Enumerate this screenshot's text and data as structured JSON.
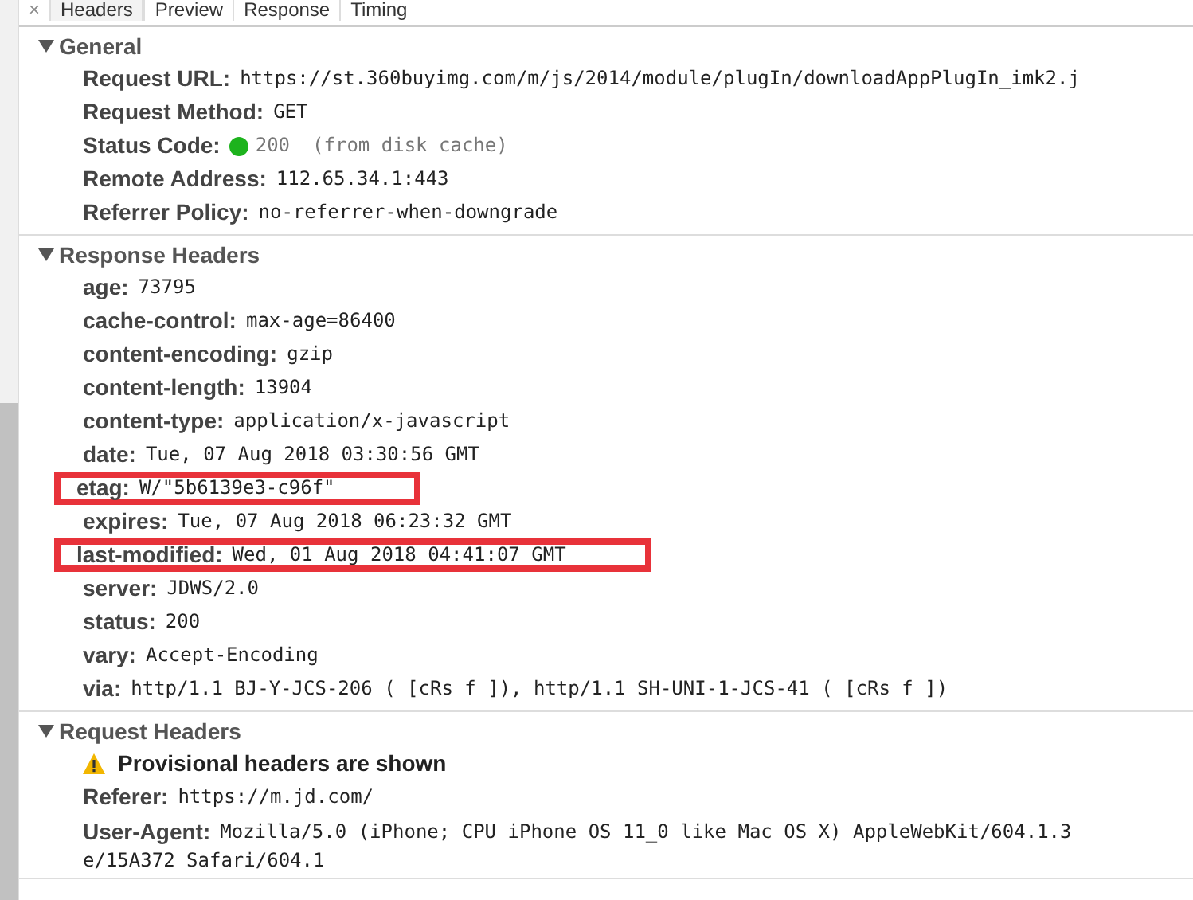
{
  "tabs": [
    {
      "label": "×",
      "kind": "close"
    },
    {
      "label": "Headers",
      "kind": "tab",
      "selected": true
    },
    {
      "label": "Preview",
      "kind": "tab",
      "selected": false
    },
    {
      "label": "Response",
      "kind": "tab",
      "selected": false
    },
    {
      "label": "Timing",
      "kind": "tab",
      "selected": false
    }
  ],
  "sections": [
    {
      "title": "General",
      "expanded": true,
      "rows": [
        {
          "key": "Request URL:",
          "value": "https://st.360buyimg.com/m/js/2014/module/plugIn/downloadAppPlugIn_imk2.j",
          "highlighted": false
        },
        {
          "key": "Request Method:",
          "value": "GET",
          "highlighted": false
        },
        {
          "key": "Status Code:",
          "kind": "status",
          "color": "#1db31d",
          "value": "200",
          "note": "(from disk cache)",
          "highlighted": false
        },
        {
          "key": "Remote Address:",
          "value": "112.65.34.1:443",
          "highlighted": false
        },
        {
          "key": "Referrer Policy:",
          "value": "no-referrer-when-downgrade",
          "highlighted": false
        }
      ]
    },
    {
      "title": "Response Headers",
      "expanded": true,
      "rows": [
        {
          "key": "age:",
          "value": "73795",
          "highlighted": false
        },
        {
          "key": "cache-control:",
          "value": "max-age=86400",
          "highlighted": false
        },
        {
          "key": "content-encoding:",
          "value": "gzip",
          "highlighted": false
        },
        {
          "key": "content-length:",
          "value": "13904",
          "highlighted": false
        },
        {
          "key": "content-type:",
          "value": "application/x-javascript",
          "highlighted": false
        },
        {
          "key": "date:",
          "value": "Tue, 07 Aug 2018 03:30:56 GMT",
          "highlighted": false
        },
        {
          "key": "etag:",
          "value": "W/\"5b6139e3-c96f\"",
          "highlighted": true
        },
        {
          "key": "expires:",
          "value": "Tue, 07 Aug 2018 06:23:32 GMT",
          "highlighted": false
        },
        {
          "key": "last-modified:",
          "value": "Wed, 01 Aug 2018 04:41:07 GMT",
          "highlighted": true
        },
        {
          "key": "server:",
          "value": "JDWS/2.0",
          "highlighted": false
        },
        {
          "key": "status:",
          "value": "200",
          "highlighted": false
        },
        {
          "key": "vary:",
          "value": "Accept-Encoding",
          "highlighted": false
        },
        {
          "key": "via:",
          "value": "http/1.1 BJ-Y-JCS-206 ( [cRs f ]), http/1.1 SH-UNI-1-JCS-41 ( [cRs f ])",
          "highlighted": false
        }
      ]
    },
    {
      "title": "Request Headers",
      "expanded": true,
      "rows": [
        {
          "kind": "warning",
          "value": "Provisional headers are shown",
          "highlighted": false
        },
        {
          "key": "Referer:",
          "value": "https://m.jd.com/",
          "highlighted": false
        },
        {
          "key": "User-Agent:",
          "value": "Mozilla/5.0 (iPhone; CPU iPhone OS 11_0 like Mac OS X) AppleWebKit/604.1.3",
          "continuation": "e/15A372 Safari/604.1",
          "highlighted": false
        }
      ]
    }
  ]
}
